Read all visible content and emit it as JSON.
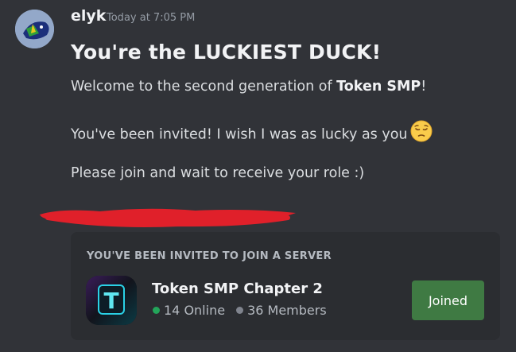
{
  "message": {
    "author": "elyk",
    "timestamp": "Today at 7:05 PM",
    "heading": "You're the LUCKIEST DUCK!",
    "line1_prefix": "Welcome to the second generation of ",
    "line1_bold": "Token SMP",
    "line1_suffix": "!",
    "line2": "You've been invited! I wish I was as lucky as you",
    "line2_emoji": "pensive-face-emoji",
    "line3": "Please join and wait to receive your role :)"
  },
  "invite": {
    "header": "YOU'VE BEEN INVITED TO JOIN A SERVER",
    "server_name": "Token SMP Chapter 2",
    "online": "14 Online",
    "members": "36 Members",
    "button_label": "Joined",
    "server_icon_letter": "T"
  },
  "colors": {
    "background": "#313338",
    "card": "#2b2d31",
    "joined_button": "#3f7a43",
    "online_dot": "#23a55a",
    "redaction": "#e0202a"
  }
}
